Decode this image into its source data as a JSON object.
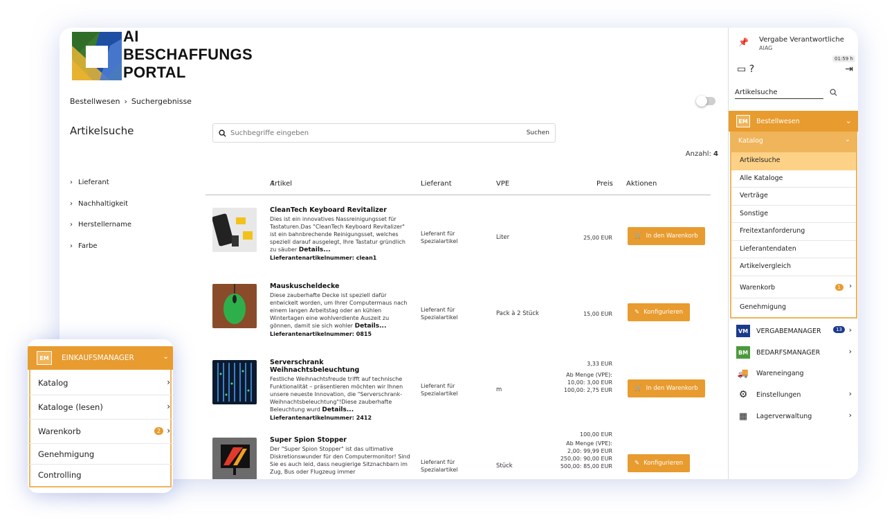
{
  "brand": {
    "line1": "AI",
    "line2": "BESCHAFFUNGS",
    "line3": "PORTAL",
    "accent": "#e89b2e"
  },
  "breadcrumb": [
    "Bestellwesen",
    "Suchergebnisse"
  ],
  "page_title": "Artikelsuche",
  "search": {
    "placeholder": "Suchbegriffe eingeben",
    "button": "Suchen"
  },
  "count": {
    "label": "Anzahl:",
    "value": "4"
  },
  "filters": [
    "Lieferant",
    "Nachhaltigkeit",
    "Herstellername",
    "Farbe"
  ],
  "table": {
    "headers": {
      "artikel": "Artikel",
      "lieferant": "Lieferant",
      "vpe": "VPE",
      "preis": "Preis",
      "aktionen": "Aktionen"
    },
    "rows": [
      {
        "title": "CleanTech Keyboard Revitalizer",
        "desc": "Dies ist ein innovatives Nassreinigungsset für Tastaturen.Das \"CleanTech Keyboard Revitalizer\" ist ein bahnbrechende Reinigungsset, welches speziell darauf ausgelegt, Ihre Tastatur gründlich zu säuber",
        "details": "Details...",
        "nr": "Lieferantenartikelnummer: clean1",
        "lieferant": "Lieferant für Spezialartikel",
        "vpe": "Liter",
        "preis": [
          "25,00  EUR"
        ],
        "action": "In den Warenkorb",
        "action_icon": "cart-icon"
      },
      {
        "title": "Mauskuscheldecke",
        "desc": "Diese zauberhafte Decke ist speziell dafür entwickelt worden, um Ihrer Computermaus nach einem langen Arbeitstag oder an kühlen Wintertagen eine wohlverdiente Auszeit zu gönnen, damit sie sich wohler",
        "details": "Details...",
        "nr": "Lieferantenartikelnummer: 0815",
        "lieferant": "Lieferant für Spezialartikel",
        "vpe": "Pack à 2 Stück",
        "preis": [
          "15,00  EUR"
        ],
        "action": "Konfigurieren",
        "action_icon": "pencil-icon"
      },
      {
        "title": "Serverschrank Weihnachtsbeleuchtung",
        "desc": "Festliche Weihnachtsfreude trifft auf technische Funktionalität – präsentieren möchten wir Ihnen unsere neueste Innovation, die \"Serverschrank-Weihnachtsbeleuchtung\"!Diese zauberhafte Beleuchtung wurd",
        "details": "Details...",
        "nr": "Lieferantenartikelnummer: 2412",
        "lieferant": "Lieferant für Spezialartikel",
        "vpe": "m",
        "preis": [
          "3,33  EUR",
          "Ab Menge (VPE):",
          "10,00: 3,00 EUR",
          "100,00: 2,75 EUR"
        ],
        "action": "In den Warenkorb",
        "action_icon": "cart-icon"
      },
      {
        "title": "Super Spion Stopper",
        "desc": "Der \"Super Spion Stopper\" ist das ultimative Diskretionswunder für den Computermonitor! Sind Sie es auch leid, dass neugierige Sitznachbarn im Zug, Bus oder Flugzeug immer",
        "details": "",
        "nr": "",
        "lieferant": "Lieferant für Spezialartikel",
        "vpe": "Stück",
        "preis": [
          "100,00  EUR",
          "Ab Menge (VPE):",
          "2,00: 99,99 EUR",
          "250,00: 90,00 EUR",
          "500,00: 85,00 EUR"
        ],
        "action": "Konfigurieren",
        "action_icon": "pencil-icon"
      }
    ]
  },
  "sidebar": {
    "user": "Vergabe Verantwortliche",
    "org": "AIAG",
    "timer": "01:59 h",
    "search_label": "Artikelsuche",
    "bestellwesen": "Bestellwesen",
    "katalog": "Katalog",
    "katalog_items": [
      "Artikelsuche",
      "Alle Kataloge",
      "Verträge",
      "Sonstige",
      "Freitextanforderung",
      "Lieferantendaten",
      "Artikelvergleich"
    ],
    "warenkorb": "Warenkorb",
    "warenkorb_count": "1",
    "genehmigung": "Genehmigung",
    "modules": [
      {
        "badge": "VM",
        "label": "VERGABEMANAGER",
        "count": "13",
        "color": "#1b3a8c"
      },
      {
        "badge": "BM",
        "label": "BEDARFSMANAGER",
        "count": "",
        "color": "#4a9a3c"
      }
    ],
    "wareneingang": "Wareneingang",
    "einstellungen": "Einstellungen",
    "lagerverwaltung": "Lagerverwaltung",
    "em_badge": "EM"
  },
  "popup": {
    "header": "EINKAUFSMANAGER",
    "items": [
      {
        "label": "Katalog",
        "count": ""
      },
      {
        "label": "Kataloge (lesen)",
        "count": ""
      },
      {
        "label": "Warenkorb",
        "count": "2"
      },
      {
        "label": "Genehmigung",
        "count": ""
      },
      {
        "label": "Controlling",
        "count": ""
      }
    ]
  }
}
